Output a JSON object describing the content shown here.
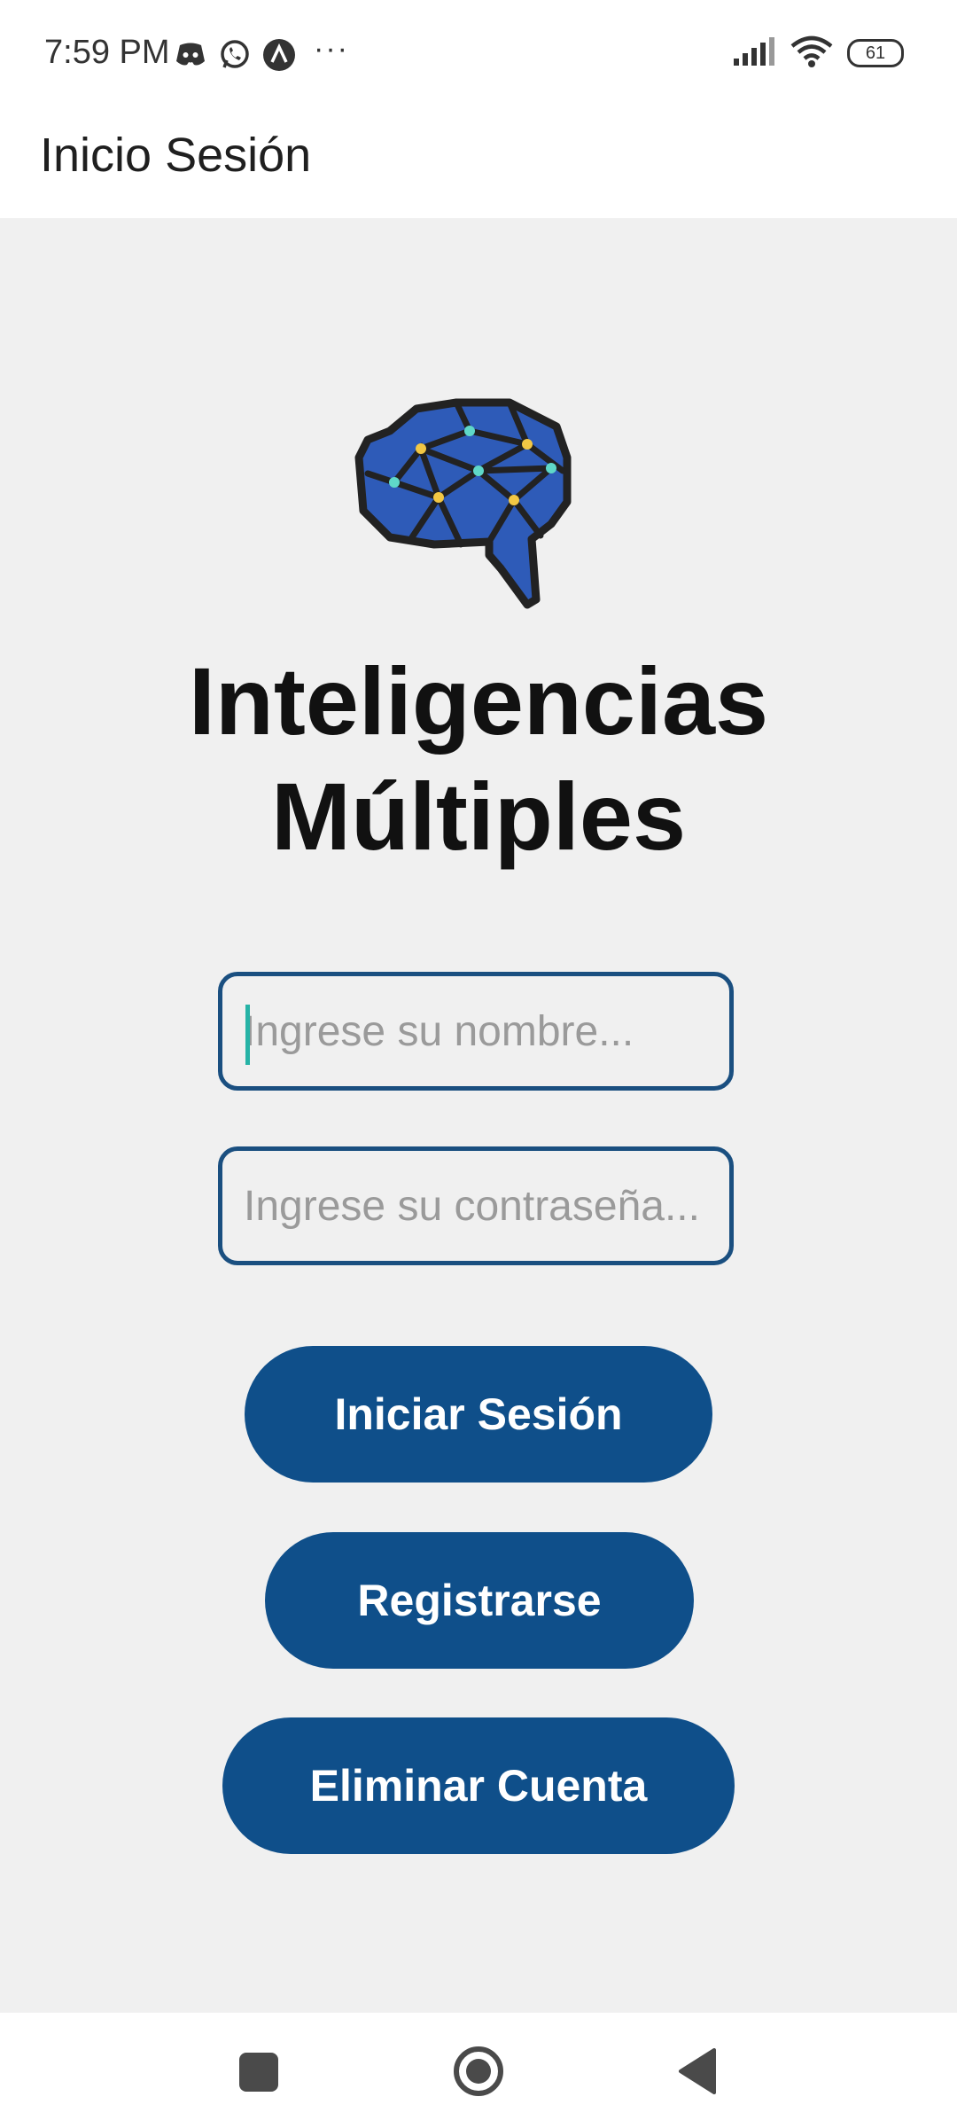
{
  "status_bar": {
    "time": "7:59 PM",
    "left_icons": [
      "discord-icon",
      "whatsapp-icon",
      "app-icon"
    ],
    "more": "···",
    "battery": "61"
  },
  "app_bar": {
    "title": "Inicio Sesión"
  },
  "main": {
    "logo": "brain-network-icon",
    "heading_line1": "Inteligencias",
    "heading_line2": "Múltiples",
    "name_field": {
      "placeholder": "Ingrese su nombre...",
      "value": ""
    },
    "password_field": {
      "placeholder": "Ingrese su contraseña...",
      "value": ""
    },
    "buttons": {
      "login": "Iniciar Sesión",
      "register": "Registrarse",
      "delete": "Eliminar Cuenta"
    }
  },
  "colors": {
    "primary": "#0f4f8a",
    "field_border": "#1a4f80",
    "background": "#f0f0f0",
    "logo_fill": "#2e5bb8",
    "caret": "#26b3a6"
  }
}
